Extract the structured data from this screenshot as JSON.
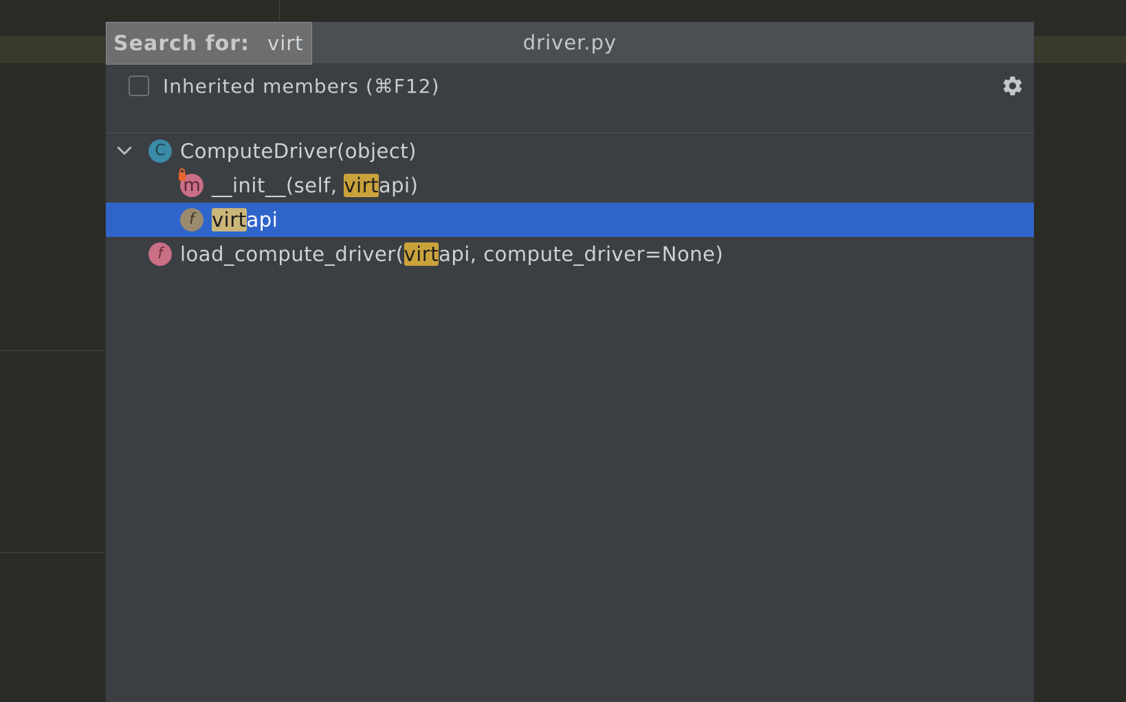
{
  "popup": {
    "search_label": "Search for:",
    "search_value": "virt",
    "file_title": "driver.py",
    "inherited_label": "Inherited members (⌘F12)",
    "inherited_checked": false
  },
  "tree": {
    "class_node": {
      "icon_letter": "C",
      "name": "ComputeDriver(object)",
      "expanded": true
    },
    "init_node": {
      "icon_letter": "m",
      "prefix": "__init__(self, ",
      "match": "virt",
      "suffix": "api)"
    },
    "field_node": {
      "icon_letter": "f",
      "prefix": "",
      "match": "virt",
      "suffix": "api",
      "selected": true
    },
    "func_node": {
      "icon_letter": "f",
      "prefix": "load_compute_driver(",
      "match": "virt",
      "suffix": "api, compute_driver=None)"
    }
  },
  "colors": {
    "selection": "#2f65ca",
    "match_highlight": "#c9a23c",
    "popup_bg": "#3b3e42",
    "editor_bg": "#2a2b25"
  },
  "icons": {
    "settings": "gear-icon",
    "expand": "chevron-down-icon"
  }
}
